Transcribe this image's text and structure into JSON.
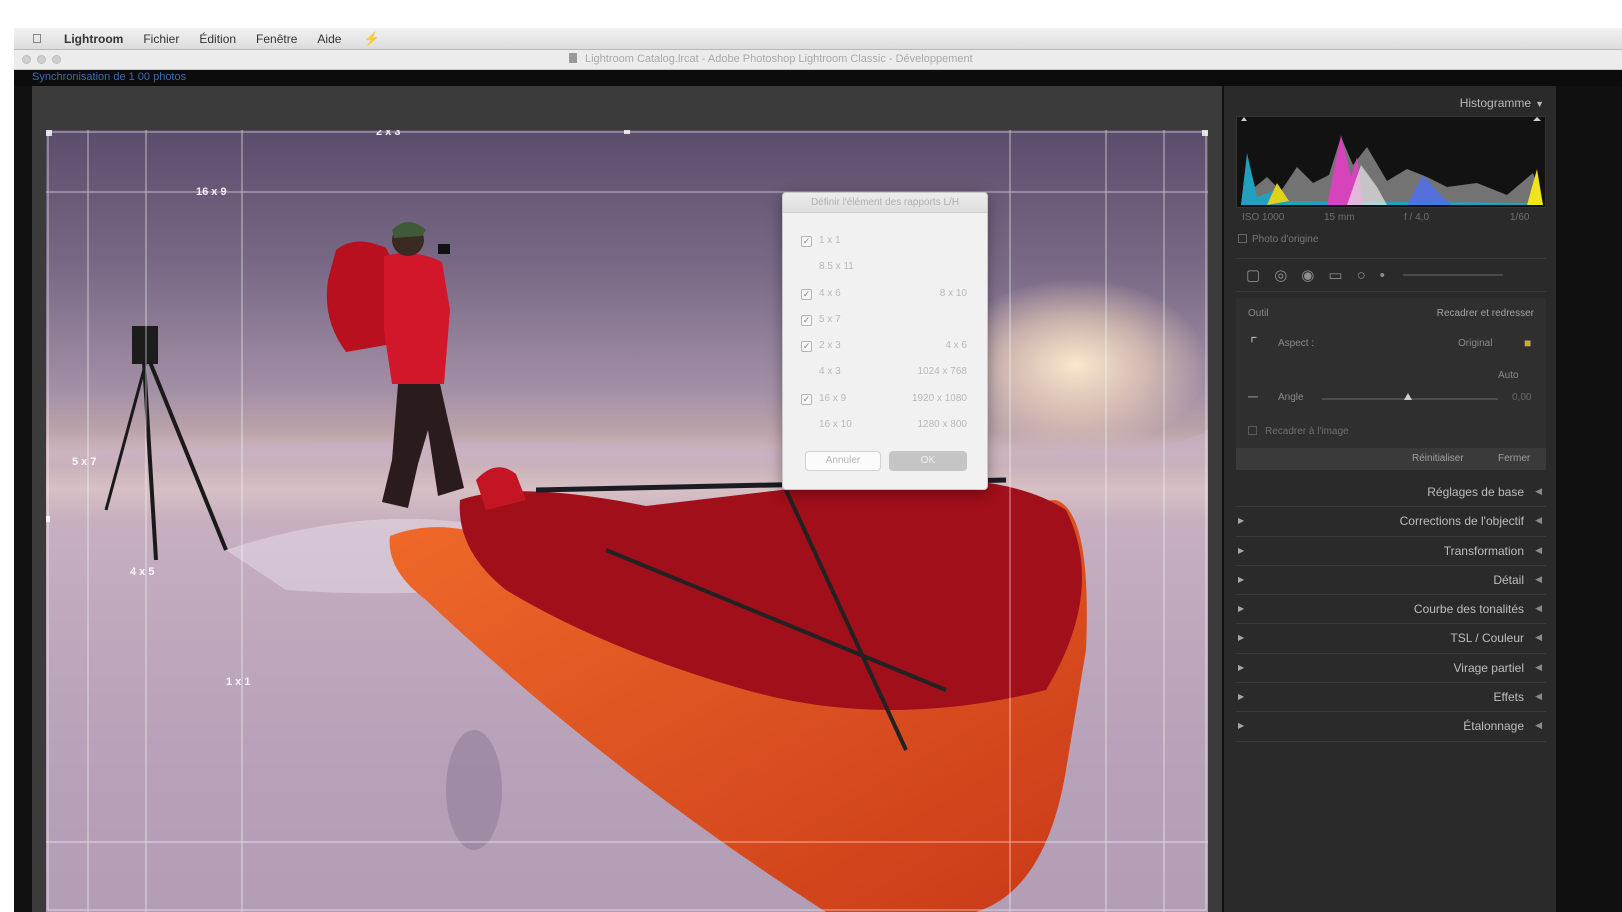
{
  "menubar": {
    "app": "Lightroom",
    "items": [
      "Fichier",
      "Édition",
      "Fenêtre",
      "Aide"
    ]
  },
  "window": {
    "title": "Lightroom Catalog.lrcat - Adobe Photoshop Lightroom Classic - Développement"
  },
  "status": {
    "sync": "Synchronisation de 1 00 photos"
  },
  "crop_overlay": {
    "labels": [
      {
        "name": "ratio-2x3",
        "text": "2 x 3"
      },
      {
        "name": "ratio-16x9",
        "text": "16 x 9"
      },
      {
        "name": "ratio-5x7",
        "text": "5 x 7"
      },
      {
        "name": "ratio-4x5",
        "text": "4 x 5"
      },
      {
        "name": "ratio-1x1",
        "text": "1 x 1"
      }
    ]
  },
  "dialog": {
    "title": "Définir l'élément des rapports L/H",
    "items": [
      {
        "label": "1 x 1",
        "right": "",
        "checked": true
      },
      {
        "label": "8.5 x 11",
        "right": "",
        "checked": false
      },
      {
        "label": "4 x 6",
        "right": "8 x 10",
        "checked": true
      },
      {
        "label": "5 x 7",
        "right": "",
        "checked": true
      },
      {
        "label": "2 x 3",
        "right": "4 x 6",
        "checked": true
      },
      {
        "label": "4 x 3",
        "right": "1024 x 768",
        "checked": false
      },
      {
        "label": "16 x 9",
        "right": "1920 x 1080",
        "checked": true
      },
      {
        "label": "16 x 10",
        "right": "1280 x 800",
        "checked": false
      }
    ],
    "cancel": "Annuler",
    "ok": "OK"
  },
  "panel": {
    "histogram_title": "Histogramme",
    "histogram_values": [
      "ISO 1000",
      "15 mm",
      "f / 4,0",
      "1/60"
    ],
    "photo_originale": "Photo d'origine",
    "tool_label": "Outil",
    "tool_name": "Recadrer et redresser",
    "aspect_label": "Aspect :",
    "aspect_value": "Original",
    "auto": "Auto",
    "angle_label": "Angle",
    "angle_value": "0,00",
    "constrain": "Recadrer à l'image",
    "reset": "Réinitialiser",
    "close": "Fermer",
    "sections": [
      "Réglages de base",
      "Corrections de l'objectif",
      "Transformation",
      "Détail",
      "Courbe des tonalités",
      "TSL / Couleur",
      "Virage partiel",
      "Effets",
      "Étalonnage"
    ]
  },
  "colors": {
    "panel_bg": "#2a2a2a",
    "lock_accent": "#c9a84a",
    "sync_text": "#3d6bb0"
  }
}
